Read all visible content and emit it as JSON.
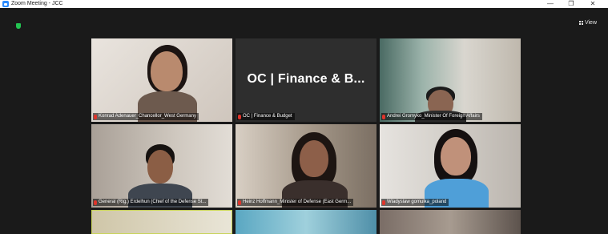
{
  "window": {
    "title": "Zoom Meeting - JCC",
    "minimize": "—",
    "restore": "❐",
    "close": "✕"
  },
  "toolbar": {
    "view_label": "View"
  },
  "colors": {
    "zoom_blue": "#2d8cff",
    "shield_green": "#23c552",
    "mic_red": "#e0342a",
    "background": "#1a1a1a"
  },
  "tiles": [
    {
      "name": "Konrad Adenauer_Chancellor_West Germany"
    },
    {
      "name": "OC | Finance & Budget",
      "display_text": "OC | Finance & B..."
    },
    {
      "name": "Andrei Gromyko_Minister Of Foreign Affairs"
    },
    {
      "name": "General (Rtg.) Erdelhun (Chief of the Defense St..."
    },
    {
      "name": "Heinz Hoffmann_Minister of Defense (East Germ..."
    },
    {
      "name": "Wladyslaw gomulka_poland"
    }
  ]
}
